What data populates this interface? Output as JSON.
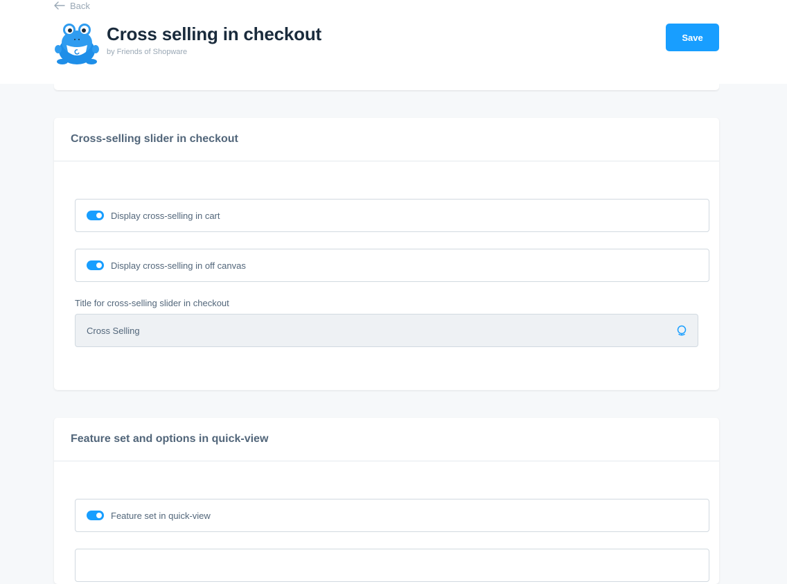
{
  "header": {
    "back_label": "Back",
    "title": "Cross selling in checkout",
    "byline": "by Friends of Shopware",
    "save_label": "Save"
  },
  "icons": {
    "back": "arrow-left-icon",
    "logo": "frog-logo-icon",
    "translate": "globe-translate-icon"
  },
  "colors": {
    "accent": "#189eff",
    "title": "#1a2b3c",
    "text": "#52667a",
    "muted": "#9aa8b5"
  },
  "cards": [
    {
      "title": "Cross-selling slider in checkout",
      "toggles": [
        {
          "label": "Display cross-selling in cart",
          "checked": true
        },
        {
          "label": "Display cross-selling in off canvas",
          "checked": true
        }
      ],
      "field": {
        "label": "Title for cross-selling slider in checkout",
        "value": "Cross Selling"
      }
    },
    {
      "title": "Feature set and options in quick-view",
      "toggles": [
        {
          "label": "Feature set in quick-view",
          "checked": true
        }
      ]
    }
  ]
}
